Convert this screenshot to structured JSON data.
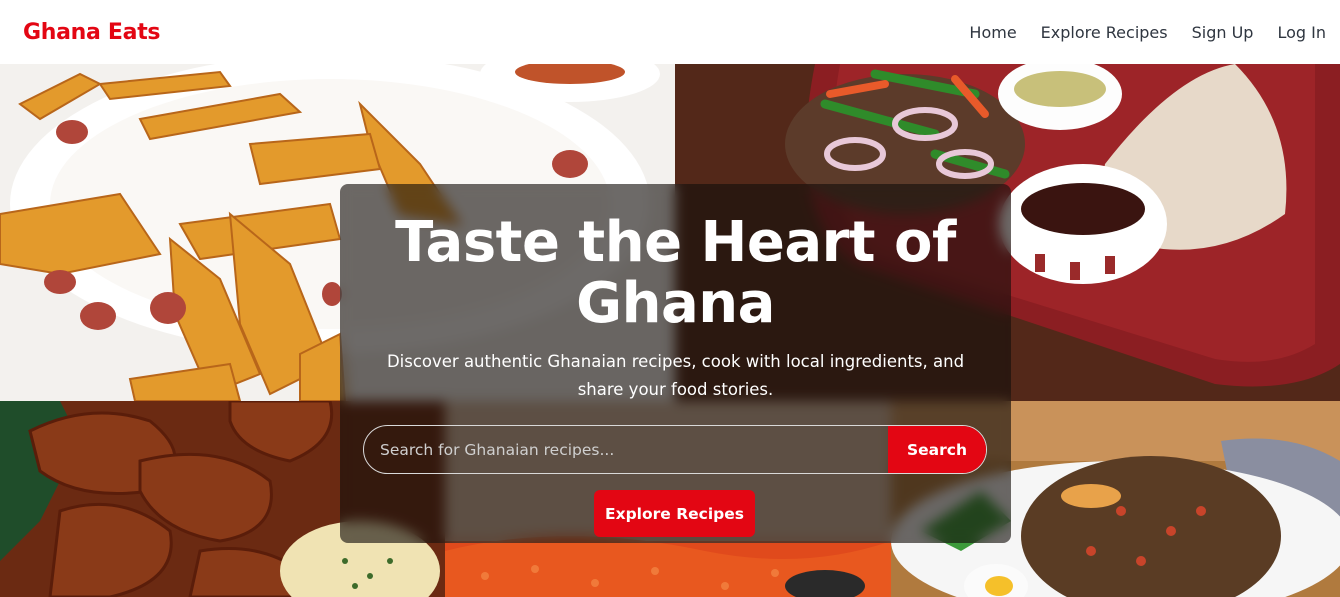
{
  "brand": {
    "name": "Ghana Eats",
    "color": "#e30613"
  },
  "nav": {
    "links": [
      {
        "label": "Home"
      },
      {
        "label": "Explore Recipes"
      },
      {
        "label": "Sign Up"
      },
      {
        "label": "Log In"
      }
    ]
  },
  "hero": {
    "title": "Taste the Heart of Ghana",
    "subtitle": "Discover authentic Ghanaian recipes, cook with local ingredients, and share your food stories.",
    "search": {
      "placeholder": "Search for Ghanaian recipes...",
      "button_label": "Search"
    },
    "cta_label": "Explore Recipes",
    "images": [
      {
        "name": "fried-plantain-image"
      },
      {
        "name": "banku-tilapia-image"
      },
      {
        "name": "meat-stew-image"
      },
      {
        "name": "jollof-rice-image"
      },
      {
        "name": "waakye-image"
      }
    ]
  }
}
